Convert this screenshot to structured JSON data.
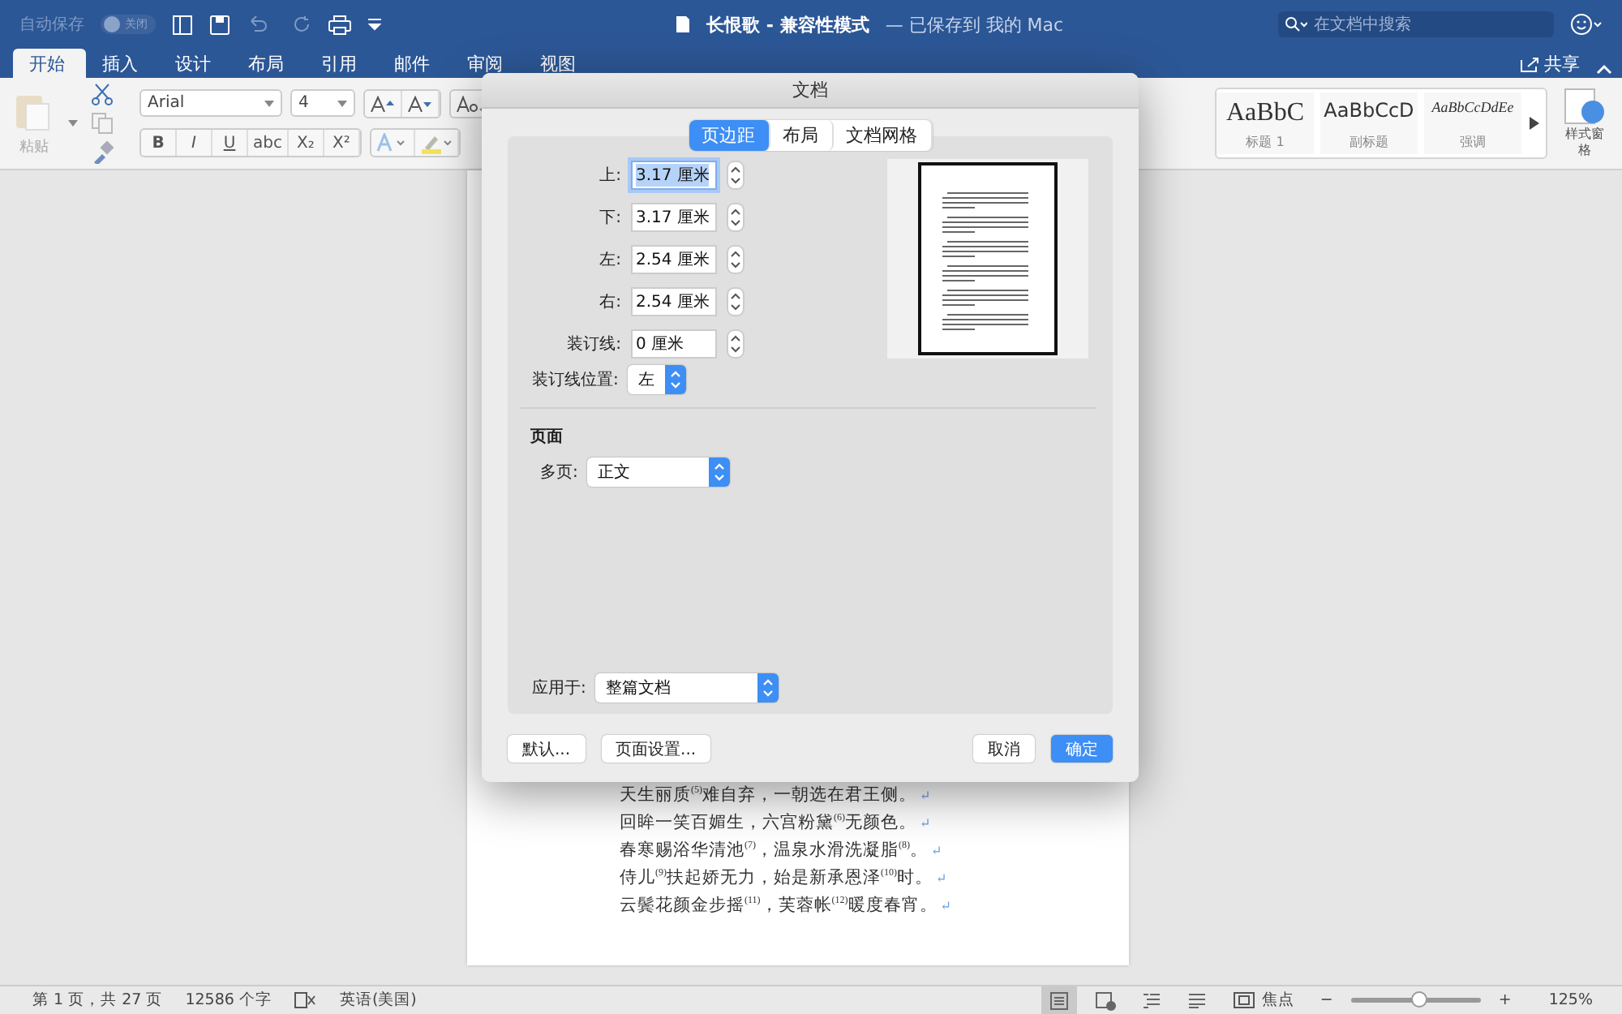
{
  "titlebar": {
    "autosave_label": "自动保存",
    "autosave_toggle": {
      "label": "关闭",
      "on": false
    },
    "title": "长恨歌 - 兼容性模式",
    "subtitle": " — 已保存到 我的 Mac",
    "search": {
      "placeholder": "在文档中搜索"
    }
  },
  "ribbon_tabs": [
    {
      "label": "开始",
      "selected": true
    },
    {
      "label": "插入",
      "selected": false
    },
    {
      "label": "设计",
      "selected": false
    },
    {
      "label": "布局",
      "selected": false
    },
    {
      "label": "引用",
      "selected": false
    },
    {
      "label": "邮件",
      "selected": false
    },
    {
      "label": "审阅",
      "selected": false
    },
    {
      "label": "视图",
      "selected": false
    }
  ],
  "share": {
    "label": "共享"
  },
  "ribbon": {
    "paste_label": "粘贴",
    "font_name": "Arial",
    "font_size": "4",
    "format_buttons": [
      "B",
      "I",
      "U",
      "abc",
      "X₂",
      "X²"
    ],
    "styles": [
      {
        "sample": "AaBbC",
        "label": "标题 1",
        "kind": "serif"
      },
      {
        "sample": "AaBbCcD",
        "label": "副标题",
        "kind": "sans"
      },
      {
        "sample": "AaBbCcDdEe",
        "label": "强调",
        "kind": "italic"
      }
    ],
    "styles_pane": "样式窗格"
  },
  "document": {
    "lines": [
      {
        "text": "天生丽质$^{(5)}$难自弃，一朝选在君王侧。",
        "mark": "↵"
      },
      {
        "text": "回眸一笑百媚生，六宫粉黛$^{(6)}$无颜色。",
        "mark": "↵"
      },
      {
        "text": "春寒赐浴华清池$^{(7)}$，温泉水滑洗凝脂$^{(8)}$。",
        "mark": "↵"
      },
      {
        "text": "侍儿$^{(9)}$扶起娇无力，始是新承恩泽$^{(10)}$时。",
        "mark": "↵"
      },
      {
        "text": "云鬓花颜金步摇$^{(11)}$，芙蓉帐$^{(12)}$暖度春宵。",
        "mark": "↵"
      }
    ]
  },
  "dialog": {
    "title": "文档",
    "tabs": [
      {
        "label": "页边距",
        "selected": true
      },
      {
        "label": "布局",
        "selected": false
      },
      {
        "label": "文档网格",
        "selected": false
      }
    ],
    "margins": [
      {
        "label": "上:",
        "value": "3.17 厘米",
        "focused": true
      },
      {
        "label": "下:",
        "value": "3.17 厘米",
        "focused": false
      },
      {
        "label": "左:",
        "value": "2.54 厘米",
        "focused": false
      },
      {
        "label": "右:",
        "value": "2.54 厘米",
        "focused": false
      },
      {
        "label": "装订线:",
        "value": "0 厘米",
        "focused": false
      }
    ],
    "gutter_position": {
      "label": "装订线位置:",
      "value": "左"
    },
    "pages_heading": "页面",
    "multiple_pages": {
      "label": "多页:",
      "value": "正文"
    },
    "apply_to": {
      "label": "应用于:",
      "value": "整篇文档"
    },
    "buttons": [
      {
        "label": "默认...",
        "kind": "plain"
      },
      {
        "label": "页面设置...",
        "kind": "plain"
      },
      {
        "label": "取消",
        "kind": "plain"
      },
      {
        "label": "确定",
        "kind": "default"
      }
    ]
  },
  "status_bar": {
    "page": "第 1 页，共 27 页",
    "words": "12586 个字",
    "language": "英语(美国)",
    "focus": "焦点",
    "zoom_out": "−",
    "zoom_in": "+",
    "zoom": {
      "level": 0.53
    },
    "zoom_reading": "125%"
  }
}
